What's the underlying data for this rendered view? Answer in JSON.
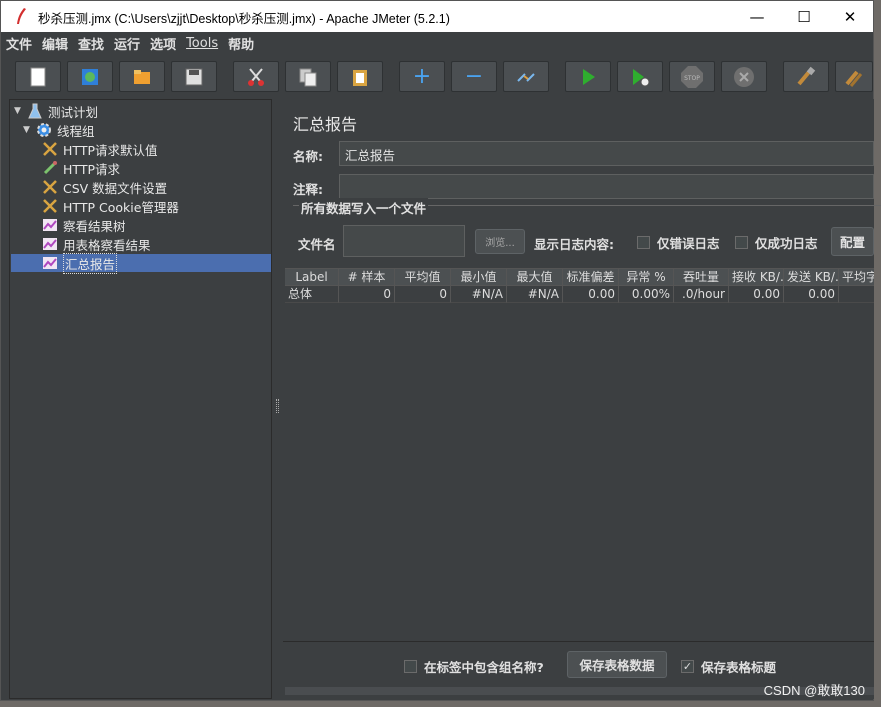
{
  "window": {
    "title": "秒杀压测.jmx (C:\\Users\\zjjt\\Desktop\\秒杀压测.jmx) - Apache JMeter (5.2.1)",
    "minimize": "—",
    "maximize": "☐",
    "close": "✕"
  },
  "menu": [
    "文件",
    "编辑",
    "查找",
    "运行",
    "选项",
    "Tools",
    "帮助"
  ],
  "toolbar": [
    {
      "name": "new-icon"
    },
    {
      "name": "templates-icon"
    },
    {
      "name": "open-icon"
    },
    {
      "name": "save-icon"
    },
    {
      "name": "cut-icon"
    },
    {
      "name": "copy-icon"
    },
    {
      "name": "paste-icon"
    },
    {
      "name": "expand-icon",
      "glyph": "+"
    },
    {
      "name": "collapse-icon",
      "glyph": "−"
    },
    {
      "name": "toggle-icon"
    },
    {
      "name": "start-icon"
    },
    {
      "name": "start-no-pause-icon"
    },
    {
      "name": "stop-icon",
      "glyph": "STOP"
    },
    {
      "name": "shutdown-icon"
    },
    {
      "name": "clear-icon"
    },
    {
      "name": "clear-all-icon"
    }
  ],
  "tree": [
    {
      "label": "测试计划",
      "icon": "flask-icon",
      "level": 0,
      "expanded": true
    },
    {
      "label": "线程组",
      "icon": "gear-icon",
      "level": 1,
      "expanded": true
    },
    {
      "label": "HTTP请求默认值",
      "icon": "wrench-icon",
      "level": 2
    },
    {
      "label": "HTTP请求",
      "icon": "pipette-icon",
      "level": 2
    },
    {
      "label": "CSV 数据文件设置",
      "icon": "wrench-icon",
      "level": 2
    },
    {
      "label": "HTTP Cookie管理器",
      "icon": "wrench-icon",
      "level": 2
    },
    {
      "label": "察看结果树",
      "icon": "chart-icon",
      "level": 2
    },
    {
      "label": "用表格察看结果",
      "icon": "chart-icon",
      "level": 2
    },
    {
      "label": "汇总报告",
      "icon": "chart-icon",
      "level": 2,
      "selected": true
    }
  ],
  "panel": {
    "title": "汇总报告",
    "name_label": "名称:",
    "name_value": "汇总报告",
    "comment_label": "注释:",
    "comment_value": "",
    "group_label": "所有数据写入一个文件",
    "filename_label": "文件名",
    "filename_value": "",
    "browse_button": "浏览...",
    "log_label": "显示日志内容:",
    "errors_only": "仅错误日志",
    "success_only": "仅成功日志",
    "config_button": "配置"
  },
  "table": {
    "headers": [
      "Label",
      "# 样本",
      "平均值",
      "最小值",
      "最大值",
      "标准偏差",
      "异常 %",
      "吞吐量",
      "接收 KB/...",
      "发送 KB/...",
      "平均字"
    ],
    "rows": [
      [
        "总体",
        "0",
        "0",
        "#N/A",
        "#N/A",
        "0.00",
        "0.00%",
        ".0/hour",
        "0.00",
        "0.00",
        ""
      ]
    ]
  },
  "bottom": {
    "include_group_label": "在标签中包含组名称?",
    "include_group_checked": false,
    "save_table_button": "保存表格数据",
    "save_header_label": "保存表格标题",
    "save_header_checked": true
  },
  "watermark": "CSDN @敢敢130",
  "colors": {
    "bg": "#3c3f41",
    "selected": "#4b6eaf",
    "accent_green": "#3fae3f",
    "accent_blue": "#3b8ee5"
  }
}
